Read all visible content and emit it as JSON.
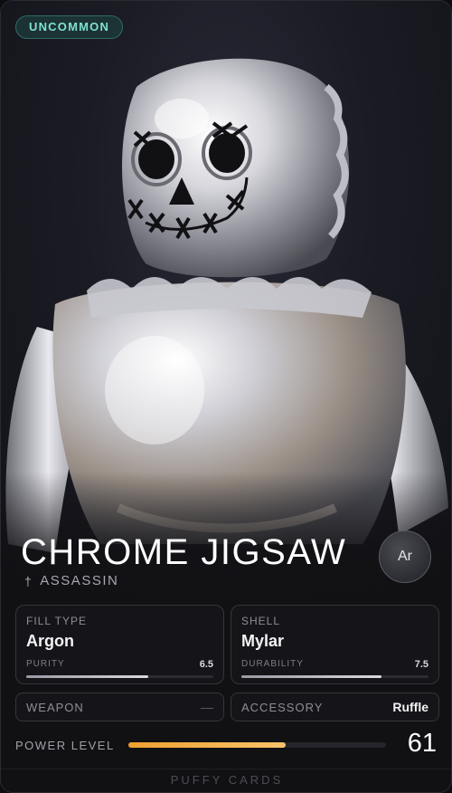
{
  "rarity": "UNCOMMON",
  "character": {
    "name": "CHROME JIGSAW",
    "class_icon": "dagger-icon",
    "class_glyph": "†",
    "class": "ASSASSIN",
    "element_symbol": "Ar"
  },
  "stats": {
    "fill": {
      "label": "FILL TYPE",
      "value": "Argon",
      "sub_label": "PURITY",
      "sub_value": "6.5",
      "fraction": 0.65
    },
    "shell": {
      "label": "SHELL",
      "value": "Mylar",
      "sub_label": "DURABILITY",
      "sub_value": "7.5",
      "fraction": 0.75
    }
  },
  "equipment": {
    "weapon": {
      "label": "WEAPON",
      "value": "—"
    },
    "accessory": {
      "label": "ACCESSORY",
      "value": "Ruffle"
    }
  },
  "power": {
    "label": "POWER LEVEL",
    "value": "61",
    "fraction": 0.61
  },
  "footer": "PUFFY CARDS",
  "colors": {
    "rarity_accent": "#7fe0cf",
    "power_bar": "#f0a030",
    "background": "#111114"
  }
}
